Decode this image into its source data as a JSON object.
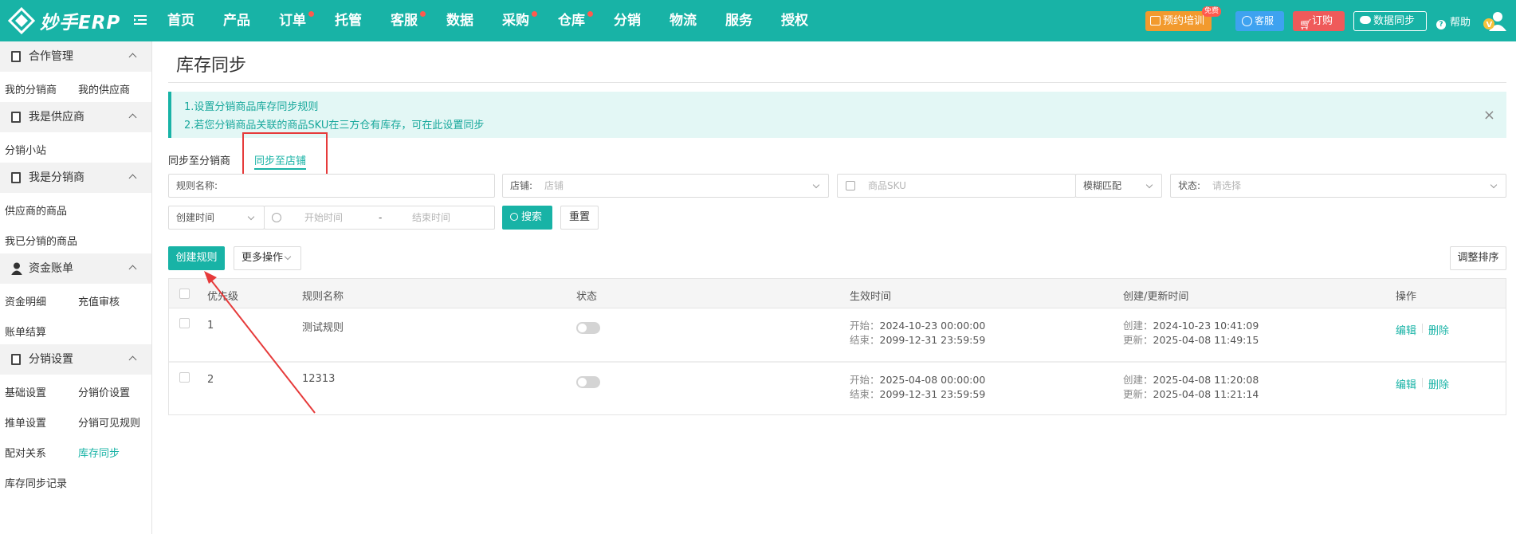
{
  "app": {
    "logo_text": "妙手ERP"
  },
  "nav": [
    {
      "label": "首页",
      "dot": false
    },
    {
      "label": "产品",
      "dot": false
    },
    {
      "label": "订单",
      "dot": true
    },
    {
      "label": "托管",
      "dot": false
    },
    {
      "label": "客服",
      "dot": true
    },
    {
      "label": "数据",
      "dot": false
    },
    {
      "label": "采购",
      "dot": true
    },
    {
      "label": "仓库",
      "dot": true
    },
    {
      "label": "分销",
      "dot": false
    },
    {
      "label": "物流",
      "dot": false
    },
    {
      "label": "服务",
      "dot": false
    },
    {
      "label": "授权",
      "dot": false
    }
  ],
  "topbar": {
    "training_label": "预约培训",
    "free_badge": "免费",
    "kefu_label": "客服",
    "order_label": "订购",
    "sync_label": "数据同步",
    "help_label": "帮助"
  },
  "colors": {
    "primary": "#18b3a6",
    "danger": "#ef5a5a",
    "warning": "#f29a2e",
    "info": "#3ea2f0",
    "dot": "#ff5a4e"
  },
  "sidebar": {
    "groups": [
      {
        "label": "合作管理",
        "icon": "clipboard-icon",
        "items": [
          "我的分销商",
          "我的供应商"
        ]
      },
      {
        "label": "我是供应商",
        "icon": "clipboard-icon",
        "items": [
          "分销小站"
        ]
      },
      {
        "label": "我是分销商",
        "icon": "clipboard-icon",
        "items": [
          "供应商的商品",
          "我已分销的商品"
        ]
      },
      {
        "label": "资金账单",
        "icon": "person-icon",
        "items": [
          "资金明细",
          "充值审核",
          "账单结算"
        ]
      },
      {
        "label": "分销设置",
        "icon": "clipboard-icon",
        "items": [
          "基础设置",
          "分销价设置",
          "推单设置",
          "分销可见规则",
          "配对关系",
          "库存同步",
          "库存同步记录"
        ]
      }
    ],
    "active_item": "库存同步"
  },
  "page": {
    "title": "库存同步",
    "notice": {
      "line1": "1.设置分销商品库存同步规则",
      "line2": "2.若您分销商品关联的商品SKU在三方仓有库存，可在此设置同步"
    },
    "tabs": [
      "同步至分销商",
      "同步至店铺"
    ],
    "active_tab": "同步至店铺"
  },
  "filters": {
    "rule_name_label": "规则名称:",
    "shop_label": "店铺:",
    "shop_placeholder": "店铺",
    "sku_placeholder": "商品SKU",
    "match_mode": "模糊匹配",
    "status_label": "状态:",
    "status_placeholder": "请选择",
    "time_type": "创建时间",
    "start_placeholder": "开始时间",
    "range_sep": "-",
    "end_placeholder": "结束时间",
    "search_label": "搜索",
    "reset_label": "重置"
  },
  "actions": {
    "create_label": "创建规则",
    "more_label": "更多操作",
    "sort_label": "调整排序"
  },
  "table": {
    "headers": [
      "优先级",
      "规则名称",
      "状态",
      "生效时间",
      "创建/更新时间",
      "操作"
    ],
    "start_key": "开始：",
    "end_key": "结束：",
    "created_key": "创建：",
    "updated_key": "更新：",
    "edit_label": "编辑",
    "delete_label": "删除",
    "rows": [
      {
        "priority": "1",
        "name": "测试规则",
        "enabled": false,
        "start": "2024-10-23 00:00:00",
        "end": "2099-12-31 23:59:59",
        "created": "2024-10-23 10:41:09",
        "updated": "2025-04-08 11:49:15"
      },
      {
        "priority": "2",
        "name": "12313",
        "enabled": false,
        "start": "2025-04-08 00:00:00",
        "end": "2099-12-31 23:59:59",
        "created": "2025-04-08 11:20:08",
        "updated": "2025-04-08 11:21:14"
      }
    ]
  }
}
